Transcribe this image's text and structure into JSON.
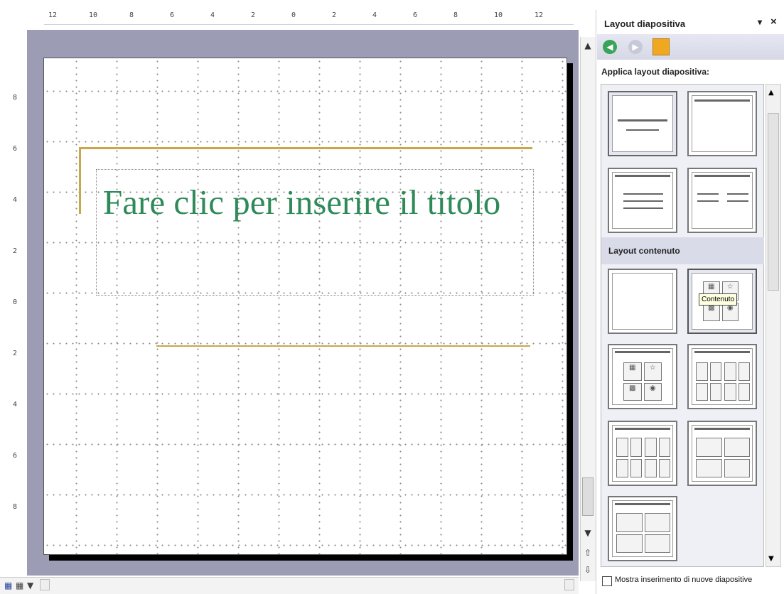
{
  "ruler": {
    "horizontal_labels": [
      "12",
      "10",
      "8",
      "6",
      "4",
      "2",
      "0",
      "2",
      "4",
      "6",
      "8",
      "10",
      "12"
    ],
    "vertical_labels": [
      "8",
      "6",
      "4",
      "2",
      "0",
      "2",
      "4",
      "6",
      "8"
    ]
  },
  "slide": {
    "title_placeholder": "Fare clic per inserire il titolo"
  },
  "task_pane": {
    "title": "Layout diapositiva",
    "dropdown_glyph": "▾",
    "close_glyph": "×",
    "nav": [
      "back-icon",
      "forward-icon",
      "home-icon"
    ],
    "section_apply": "Applica layout diapositiva:",
    "section_content": "Layout contenuto",
    "tooltip": "Contenuto",
    "checkbox_label": "Mostra inserimento di nuove diapositive"
  },
  "colors": {
    "accent_gold": "#c8a84a",
    "title_green": "#2f8a59",
    "edit_bg": "#9c9db4"
  }
}
